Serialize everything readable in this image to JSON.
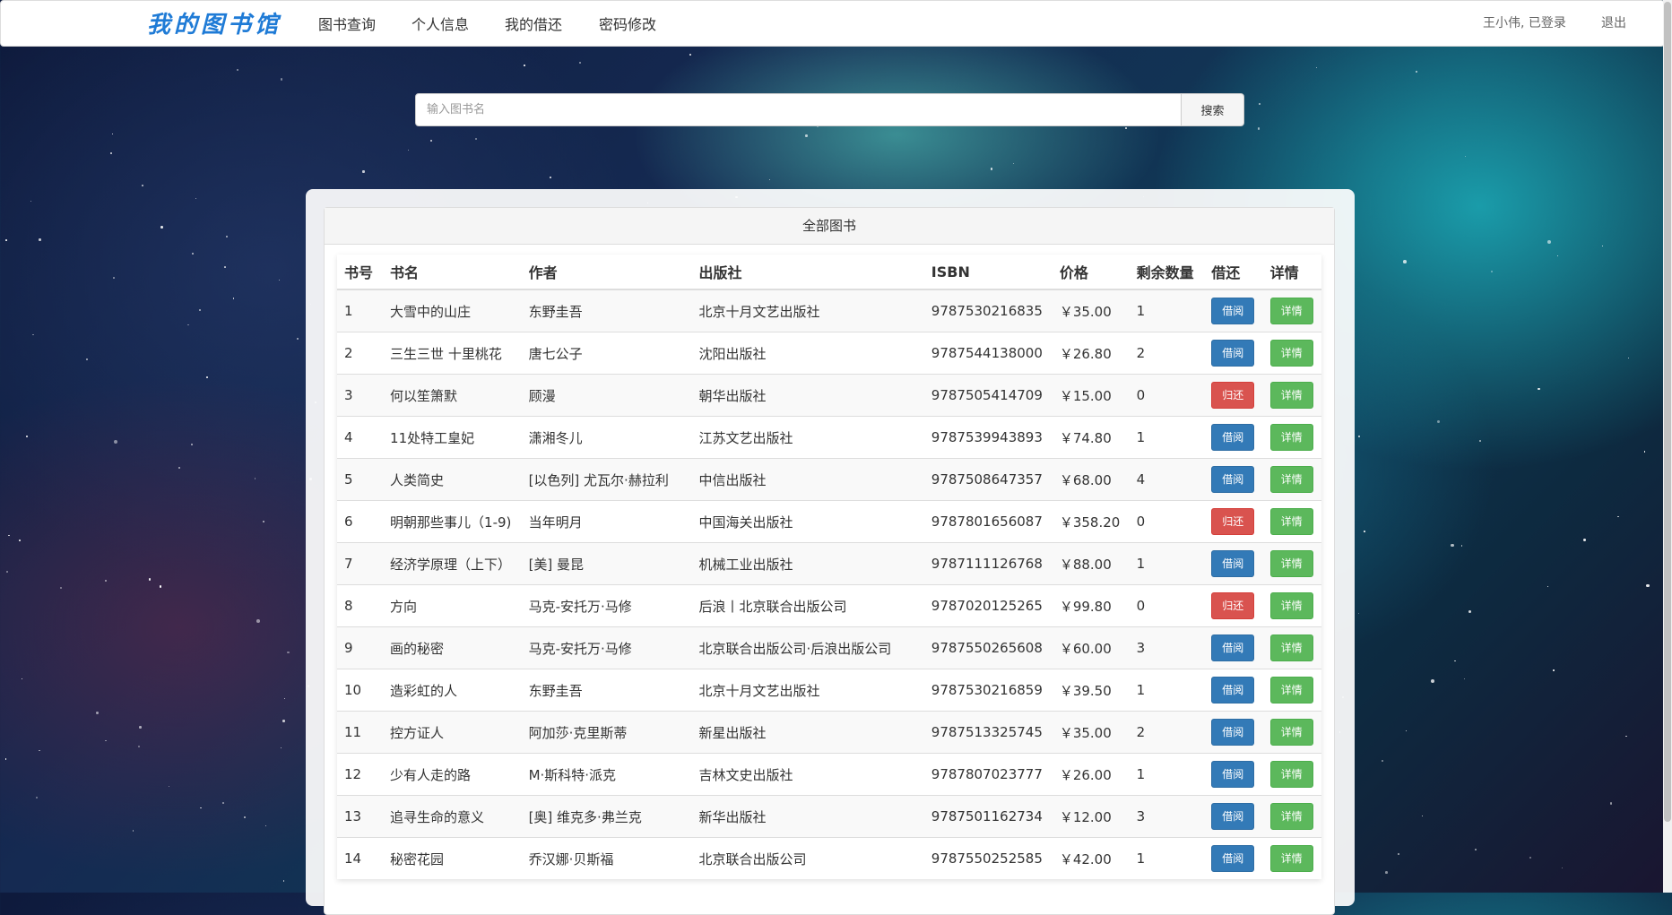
{
  "navbar": {
    "brand": "我的图书馆",
    "links": [
      "图书查询",
      "个人信息",
      "我的借还",
      "密码修改"
    ],
    "user_status": "王小伟, 已登录",
    "logout": "退出"
  },
  "search": {
    "placeholder": "输入图书名",
    "button": "搜索"
  },
  "panel": {
    "title": "全部图书"
  },
  "table": {
    "headers": [
      "书号",
      "书名",
      "作者",
      "出版社",
      "ISBN",
      "价格",
      "剩余数量",
      "借还",
      "详情"
    ],
    "rows": [
      {
        "id": "1",
        "title": "大雪中的山庄",
        "author": "东野圭吾",
        "publisher": "北京十月文艺出版社",
        "isbn": "9787530216835",
        "price": "￥35.00",
        "remaining": "1",
        "action": "借阅",
        "action_type": "borrow",
        "detail": "详情"
      },
      {
        "id": "2",
        "title": "三生三世 十里桃花",
        "author": "唐七公子",
        "publisher": "沈阳出版社",
        "isbn": "9787544138000",
        "price": "￥26.80",
        "remaining": "2",
        "action": "借阅",
        "action_type": "borrow",
        "detail": "详情"
      },
      {
        "id": "3",
        "title": "何以笙箫默",
        "author": "顾漫",
        "publisher": "朝华出版社",
        "isbn": "9787505414709",
        "price": "￥15.00",
        "remaining": "0",
        "action": "归还",
        "action_type": "return",
        "detail": "详情"
      },
      {
        "id": "4",
        "title": "11处特工皇妃",
        "author": "潇湘冬儿",
        "publisher": "江苏文艺出版社",
        "isbn": "9787539943893",
        "price": "￥74.80",
        "remaining": "1",
        "action": "借阅",
        "action_type": "borrow",
        "detail": "详情"
      },
      {
        "id": "5",
        "title": "人类简史",
        "author": "[以色列] 尤瓦尔·赫拉利",
        "publisher": "中信出版社",
        "isbn": "9787508647357",
        "price": "￥68.00",
        "remaining": "4",
        "action": "借阅",
        "action_type": "borrow",
        "detail": "详情"
      },
      {
        "id": "6",
        "title": "明朝那些事儿（1-9)",
        "author": "当年明月",
        "publisher": "中国海关出版社",
        "isbn": "9787801656087",
        "price": "￥358.20",
        "remaining": "0",
        "action": "归还",
        "action_type": "return",
        "detail": "详情"
      },
      {
        "id": "7",
        "title": "经济学原理（上下）",
        "author": "[美] 曼昆",
        "publisher": "机械工业出版社",
        "isbn": "9787111126768",
        "price": "￥88.00",
        "remaining": "1",
        "action": "借阅",
        "action_type": "borrow",
        "detail": "详情"
      },
      {
        "id": "8",
        "title": "方向",
        "author": "马克-安托万·马修",
        "publisher": "后浪丨北京联合出版公司",
        "isbn": "9787020125265",
        "price": "￥99.80",
        "remaining": "0",
        "action": "归还",
        "action_type": "return",
        "detail": "详情"
      },
      {
        "id": "9",
        "title": "画的秘密",
        "author": "马克-安托万·马修",
        "publisher": "北京联合出版公司·后浪出版公司",
        "isbn": "9787550265608",
        "price": "￥60.00",
        "remaining": "3",
        "action": "借阅",
        "action_type": "borrow",
        "detail": "详情"
      },
      {
        "id": "10",
        "title": "造彩虹的人",
        "author": "东野圭吾",
        "publisher": "北京十月文艺出版社",
        "isbn": "9787530216859",
        "price": "￥39.50",
        "remaining": "1",
        "action": "借阅",
        "action_type": "borrow",
        "detail": "详情"
      },
      {
        "id": "11",
        "title": "控方证人",
        "author": "阿加莎·克里斯蒂",
        "publisher": "新星出版社",
        "isbn": "9787513325745",
        "price": "￥35.00",
        "remaining": "2",
        "action": "借阅",
        "action_type": "borrow",
        "detail": "详情"
      },
      {
        "id": "12",
        "title": "少有人走的路",
        "author": "M·斯科特·派克",
        "publisher": "吉林文史出版社",
        "isbn": "9787807023777",
        "price": "￥26.00",
        "remaining": "1",
        "action": "借阅",
        "action_type": "borrow",
        "detail": "详情"
      },
      {
        "id": "13",
        "title": "追寻生命的意义",
        "author": "[奥] 维克多·弗兰克",
        "publisher": "新华出版社",
        "isbn": "9787501162734",
        "price": "￥12.00",
        "remaining": "3",
        "action": "借阅",
        "action_type": "borrow",
        "detail": "详情"
      },
      {
        "id": "14",
        "title": "秘密花园",
        "author": "乔汉娜·贝斯福",
        "publisher": "北京联合出版公司",
        "isbn": "9787550252585",
        "price": "￥42.00",
        "remaining": "1",
        "action": "借阅",
        "action_type": "borrow",
        "detail": "详情"
      }
    ]
  },
  "colors": {
    "brand": "#1f7bd6",
    "borrow": "#337ab7",
    "return": "#d9534f",
    "detail": "#5cb85c"
  }
}
